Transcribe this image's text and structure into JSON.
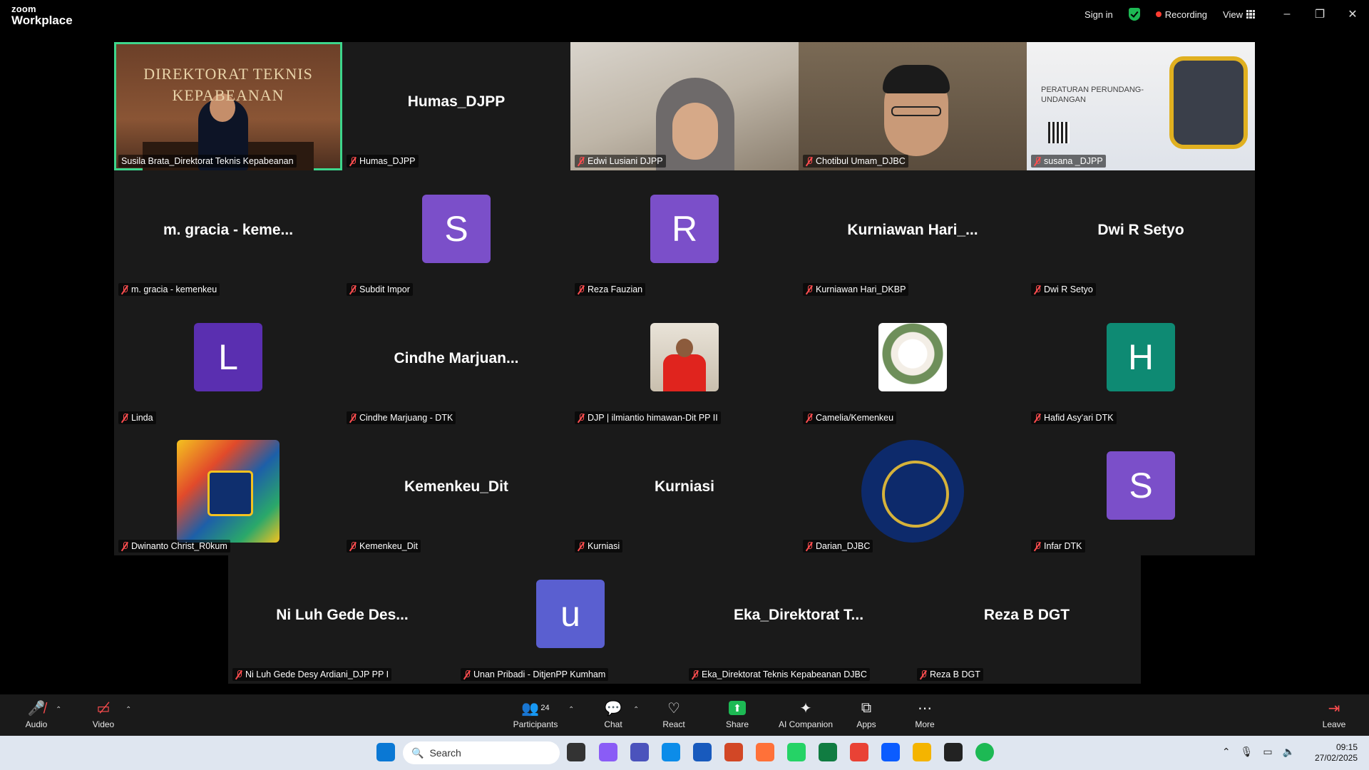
{
  "app": {
    "brand_top": "zoom",
    "brand_bottom": "Workplace"
  },
  "titlebar": {
    "sign_in": "Sign in",
    "recording": "Recording",
    "view": "View",
    "minimize": "–",
    "restore": "❐",
    "close": "✕"
  },
  "tiles": [
    {
      "name": "Susila Brata_Direktorat Teknis Kepabeanan",
      "type": "video",
      "video": "room",
      "sign": "DIREKTORAT TEKNIS KEPABEANAN",
      "active": true
    },
    {
      "name": "Humas_DJPP",
      "type": "name",
      "display": "Humas_DJPP"
    },
    {
      "name": "Edwi Lusiani DJPP",
      "type": "video",
      "video": "wall"
    },
    {
      "name": "Chotibul Umam_DJBC",
      "type": "video",
      "video": "man"
    },
    {
      "name": "susana _DJPP",
      "type": "video",
      "video": "poster",
      "poster_text": "PERATURAN PERUNDANG-UNDANGAN"
    },
    {
      "name": "m. gracia - kemenkeu",
      "type": "name",
      "display": "m. gracia - keme..."
    },
    {
      "name": "Subdit Impor",
      "type": "avatar",
      "letter": "S",
      "color": "#7b4fc9"
    },
    {
      "name": "Reza Fauzian",
      "type": "avatar",
      "letter": "R",
      "color": "#7b4fc9"
    },
    {
      "name": "Kurniawan Hari_DKBP",
      "type": "name",
      "display": "Kurniawan  Hari_..."
    },
    {
      "name": "Dwi R Setyo",
      "type": "name",
      "display": "Dwi R Setyo"
    },
    {
      "name": "Linda",
      "type": "avatar",
      "letter": "L",
      "color": "#5a2fb0"
    },
    {
      "name": "Cindhe Marjuang - DTK",
      "type": "name",
      "display": "Cindhe  Marjuan..."
    },
    {
      "name": "DJP | ilmiantio himawan-Dit PP II",
      "type": "image",
      "image": "photo"
    },
    {
      "name": "Camelia/Kemenkeu",
      "type": "image",
      "image": "flowers"
    },
    {
      "name": "Hafid Asy'ari DTK",
      "type": "avatar",
      "letter": "H",
      "color": "#0e8a73"
    },
    {
      "name": "Dwinanto Christ_R0kum",
      "type": "image",
      "image": "art",
      "large": true
    },
    {
      "name": "Kemenkeu_Dit",
      "type": "name",
      "display": "Kemenkeu_Dit"
    },
    {
      "name": "Kurniasi",
      "type": "name",
      "display": "Kurniasi"
    },
    {
      "name": "Darian_DJBC",
      "type": "image",
      "image": "emblem",
      "large": true
    },
    {
      "name": "Infar DTK",
      "type": "avatar",
      "letter": "S",
      "color": "#7b4fc9"
    },
    {
      "name": "Ni Luh Gede Desy Ardiani_DJP PP I",
      "type": "name",
      "display": "Ni Luh Gede Des..."
    },
    {
      "name": "Unan Pribadi - DitjenPP Kumham",
      "type": "avatar",
      "letter": "u",
      "color": "#5a5fd0"
    },
    {
      "name": "Eka_Direktorat Teknis Kepabeanan DJBC",
      "type": "name",
      "display": "Eka_Direktorat T..."
    },
    {
      "name": "Reza B DGT",
      "type": "name",
      "display": "Reza B DGT"
    }
  ],
  "toolbar": {
    "audio": "Audio",
    "video": "Video",
    "participants": "Participants",
    "participants_count": "24",
    "chat": "Chat",
    "react": "React",
    "share": "Share",
    "ai_companion": "AI Companion",
    "apps": "Apps",
    "more": "More",
    "leave": "Leave"
  },
  "taskbar": {
    "search_placeholder": "Search",
    "time": "09:15",
    "date": "27/02/2025"
  },
  "colors": {
    "active_speaker": "#3dd68c",
    "share_green": "#1db954",
    "recording_red": "#ff3b30"
  }
}
